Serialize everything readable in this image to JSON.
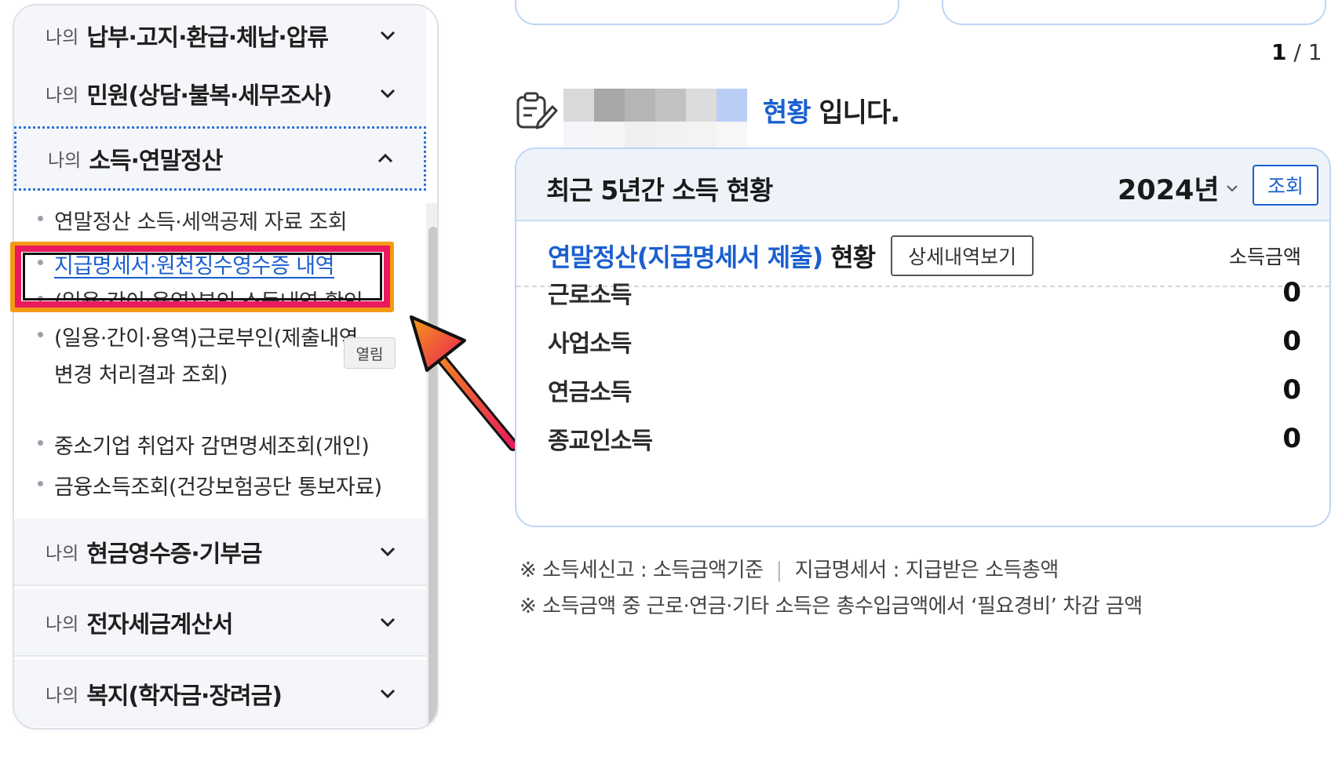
{
  "sidebar": {
    "accordions": [
      {
        "prefix": "나의",
        "title": "납부·고지·환급·체납·압류",
        "expanded": false
      },
      {
        "prefix": "나의",
        "title": "민원(상담·불복·세무조사)",
        "expanded": false
      },
      {
        "prefix": "나의",
        "title": "소득·연말정산",
        "expanded": true
      },
      {
        "prefix": "나의",
        "title": "현금영수증·기부금",
        "expanded": false
      },
      {
        "prefix": "나의",
        "title": "전자세금계산서",
        "expanded": false
      },
      {
        "prefix": "나의",
        "title": "복지(학자금·장려금)",
        "expanded": false
      }
    ],
    "submenu": [
      {
        "label": "연말정산 소득·세액공제 자료 조회",
        "state": "partially-hidden"
      },
      {
        "label": "지급명세서·원천징수영수증 내역",
        "state": "active"
      },
      {
        "label": "(일용·간이·용역)본인 소득내역 확인",
        "state": "partially-hidden"
      },
      {
        "label": "(일용·간이·용역)근로부인(제출내역",
        "label_line2": "변경 처리결과 조회)",
        "state": "normal"
      },
      {
        "label": "중소기업 취업자 감면명세조회(개인)",
        "state": "normal"
      },
      {
        "label": "금융소득조회(건강보험공단 통보자료)",
        "state": "normal"
      }
    ],
    "tooltip": "열림"
  },
  "pagination": {
    "current": "1",
    "separator": "/",
    "total": "1"
  },
  "status": {
    "highlight": "현황",
    "suffix": " 입니다."
  },
  "income_card": {
    "title": "최근 5년간 소득 현황",
    "year": "2024년",
    "lookup_button": "조회",
    "summary_label": "연말정산(지급명세서 제출)",
    "summary_suffix": "현황",
    "detail_button": "상세내역보기",
    "amount_header": "소득금액",
    "rows": [
      {
        "label": "근로소득",
        "value": "0"
      },
      {
        "label": "사업소득",
        "value": "0"
      },
      {
        "label": "연금소득",
        "value": "0"
      },
      {
        "label": "종교인소득",
        "value": "0"
      }
    ]
  },
  "notes": {
    "line1_a": "※ 소득세신고 : 소득금액기준",
    "line1_sep": "|",
    "line1_b": "지급명세서 : 지급받은 소득총액",
    "line2": "※ 소득금액 중 근로·연금·기타 소득은 총수입금액에서 ‘필요경비’ 차감 금액"
  },
  "colors": {
    "accent_blue": "#1a5fd0",
    "highlight_orange": "#f59a15",
    "highlight_pink": "#ea1a5c",
    "card_border": "#bcd6f5"
  },
  "icons": [
    "chevron-down-icon",
    "chevron-up-icon",
    "form-edit-icon",
    "pointer-arrow-icon"
  ]
}
